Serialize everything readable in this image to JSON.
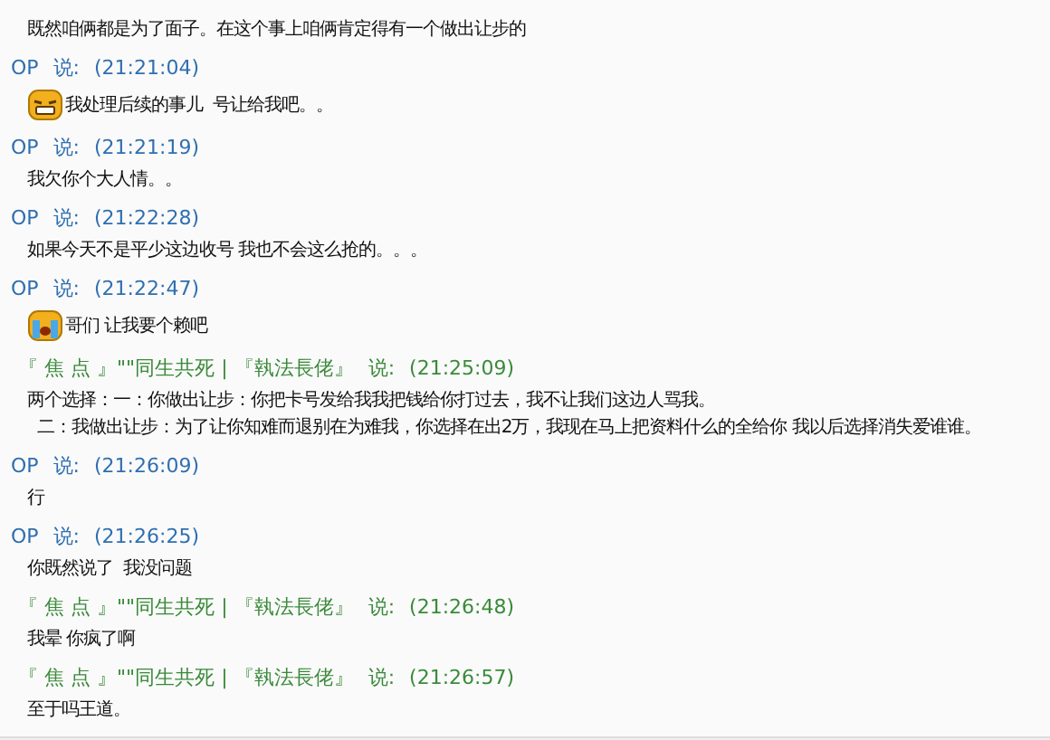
{
  "messages": [
    {
      "lines": [
        "既然咱俩都是为了面子。在这个事上咱俩肯定得有一个做出让步的"
      ]
    },
    {
      "sender": {
        "name": "OP",
        "kind": "self"
      },
      "said": "说:",
      "time": "(21:21:04)",
      "emoji": {
        "kind": "grin"
      },
      "lines": [
        "我处理后续的事儿  号让给我吧。。"
      ]
    },
    {
      "sender": {
        "name": "OP",
        "kind": "self"
      },
      "said": "说:",
      "time": "(21:21:19)",
      "lines": [
        "我欠你个大人情。。"
      ]
    },
    {
      "sender": {
        "name": "OP",
        "kind": "self"
      },
      "said": "说:",
      "time": "(21:22:28)",
      "lines": [
        "如果今天不是平少这边收号 我也不会这么抢的。。。"
      ]
    },
    {
      "sender": {
        "name": "OP",
        "kind": "self"
      },
      "said": "说:",
      "time": "(21:22:47)",
      "emoji": {
        "kind": "cry"
      },
      "lines": [
        "哥们 让我要个赖吧"
      ]
    },
    {
      "sender": {
        "name": "『 焦 点 』\"\"同生共死 | 『執法長佬』",
        "kind": "other"
      },
      "said": "说:",
      "time": "(21:25:09)",
      "lines": [
        "两个选择：一：你做出让步：你把卡号发给我我把钱给你打过去，我不让我们这边人骂我。",
        "  二：我做出让步：为了让你知难而退别在为难我，你选择在出2万，我现在马上把资料什么的全给你 我以后选择消失爱谁谁。"
      ]
    },
    {
      "sender": {
        "name": "OP",
        "kind": "self"
      },
      "said": "说:",
      "time": "(21:26:09)",
      "lines": [
        "行"
      ]
    },
    {
      "sender": {
        "name": "OP",
        "kind": "self"
      },
      "said": "说:",
      "time": "(21:26:25)",
      "lines": [
        "你既然说了  我没问题"
      ]
    },
    {
      "sender": {
        "name": "『 焦 点 』\"\"同生共死 | 『執法長佬』",
        "kind": "other"
      },
      "said": "说:",
      "time": "(21:26:48)",
      "lines": [
        "我晕 你疯了啊"
      ]
    },
    {
      "sender": {
        "name": "『 焦 点 』\"\"同生共死 | 『執法長佬』",
        "kind": "other"
      },
      "said": "说:",
      "time": "(21:26:57)",
      "lines": [
        "至于吗王道。"
      ]
    }
  ]
}
